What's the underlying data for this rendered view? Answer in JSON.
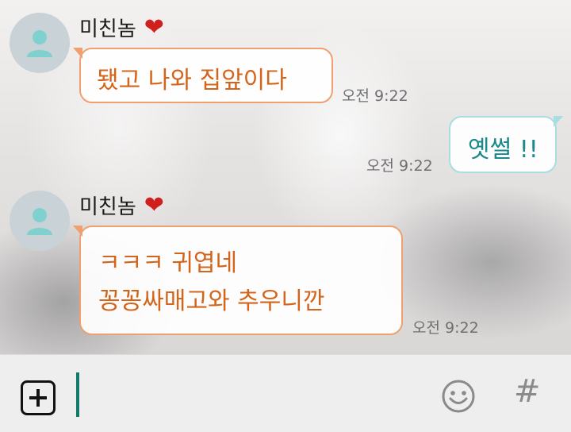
{
  "messages": [
    {
      "sender": "미친놈",
      "heart": "❤",
      "text": "됐고 나와 집앞이다",
      "time": "오전 9:22",
      "direction": "incoming"
    },
    {
      "text": "옛썰 !!",
      "time": "오전 9:22",
      "direction": "outgoing"
    },
    {
      "sender": "미친놈",
      "heart": "❤",
      "lines": [
        "ㅋㅋㅋ 귀엽네",
        "꽁꽁싸매고와 추우니깐"
      ],
      "time": "오전 9:22",
      "direction": "incoming"
    }
  ],
  "input_bar": {
    "plus_icon": "plus-box-icon",
    "emoji_icon": "smiley-icon",
    "hash_label": "#"
  },
  "colors": {
    "incoming_border": "#f0a070",
    "incoming_text": "#d4641a",
    "outgoing_border": "#a8dde2",
    "outgoing_text": "#1a8a8a",
    "cursor": "#137a6a"
  }
}
